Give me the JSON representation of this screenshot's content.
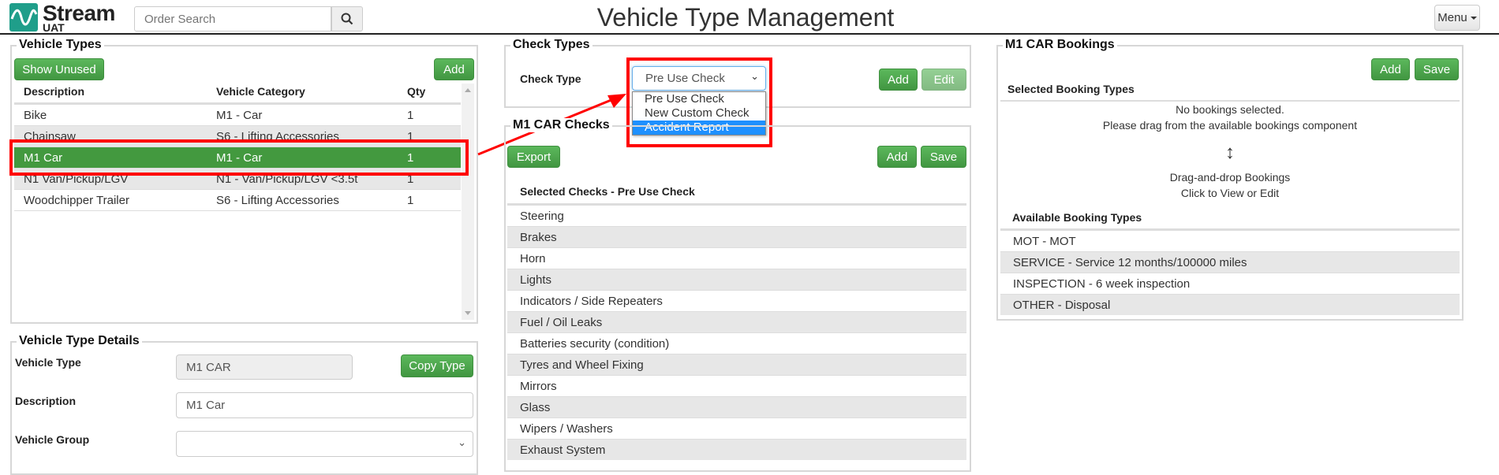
{
  "header": {
    "logo_name": "Stream",
    "logo_sub": "UAT",
    "search_placeholder": "Order Search",
    "title": "Vehicle Type Management",
    "menu_label": "Menu"
  },
  "vehicle_types": {
    "legend": "Vehicle Types",
    "show_unused": "Show Unused",
    "add": "Add",
    "columns": [
      "Description",
      "Vehicle Category",
      "Qty"
    ],
    "rows": [
      {
        "description": "Bike",
        "category": "M1 - Car",
        "qty": "1"
      },
      {
        "description": "Chainsaw",
        "category": "S6 - Lifting Accessories",
        "qty": "1"
      },
      {
        "description": "M1 Car",
        "category": "M1 - Car",
        "qty": "1",
        "selected": true
      },
      {
        "description": "N1 Van/Pickup/LGV",
        "category": "N1 - Van/Pickup/LGV <3.5t",
        "qty": "1"
      },
      {
        "description": "Woodchipper Trailer",
        "category": "S6 - Lifting Accessories",
        "qty": "1"
      }
    ]
  },
  "vehicle_type_details": {
    "legend": "Vehicle Type Details",
    "vehicle_type_label": "Vehicle Type",
    "vehicle_type_value": "M1 CAR",
    "copy_type": "Copy Type",
    "description_label": "Description",
    "description_value": "M1 Car",
    "vehicle_group_label": "Vehicle Group",
    "vehicle_group_value": ""
  },
  "check_types": {
    "legend": "Check Types",
    "label": "Check Type",
    "selected": "Pre Use Check",
    "options": [
      "Pre Use Check",
      "New Custom Check",
      "Accident Report"
    ],
    "highlighted_option": "Accident Report",
    "add": "Add",
    "edit": "Edit"
  },
  "checks": {
    "legend": "M1 CAR Checks",
    "export": "Export",
    "add": "Add",
    "save": "Save",
    "heading": "Selected Checks - Pre Use Check",
    "items": [
      "Steering",
      "Brakes",
      "Horn",
      "Lights",
      "Indicators / Side Repeaters",
      "Fuel / Oil Leaks",
      "Batteries security (condition)",
      "Tyres and Wheel Fixing",
      "Mirrors",
      "Glass",
      "Wipers / Washers",
      "Exhaust System"
    ]
  },
  "bookings": {
    "legend": "M1 CAR Bookings",
    "add": "Add",
    "save": "Save",
    "selected_heading": "Selected Booking Types",
    "empty_line1": "No bookings selected.",
    "empty_line2": "Please drag from the available bookings component",
    "arrow_glyph": "↕",
    "dnd_line1": "Drag-and-drop Bookings",
    "dnd_line2": "Click to View or Edit",
    "available_heading": "Available Booking Types",
    "available": [
      "MOT - MOT",
      "SERVICE - Service 12 months/100000 miles",
      "INSPECTION - 6 week inspection",
      "OTHER - Disposal"
    ]
  },
  "colors": {
    "accent_green": "#449d44",
    "selected_row": "#43993f",
    "highlight_blue": "#1e90ff",
    "annotation_red": "#ff0000"
  }
}
